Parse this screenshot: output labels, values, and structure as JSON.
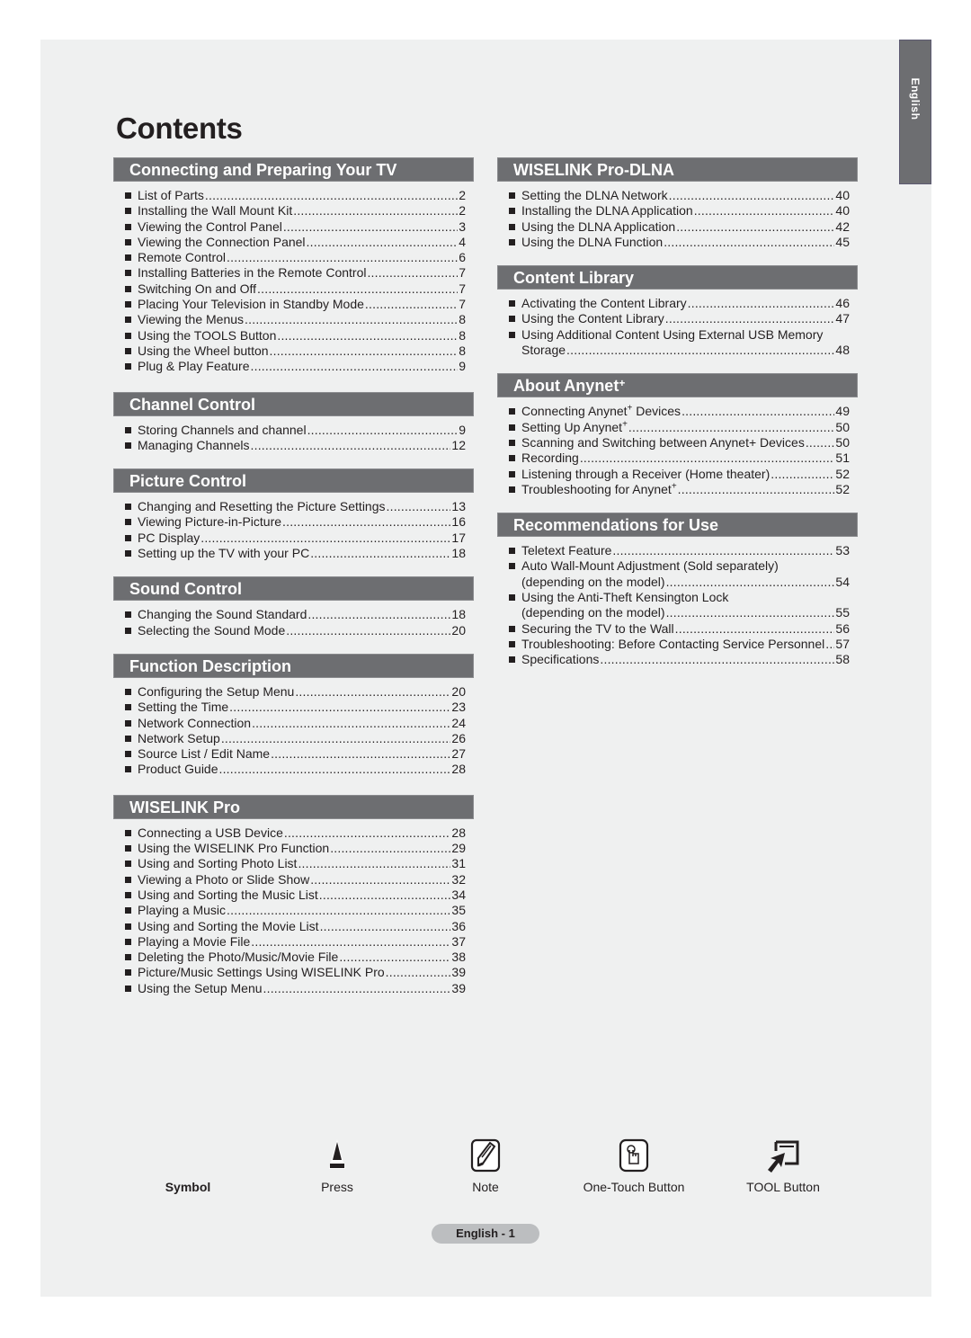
{
  "side_tab": "English",
  "title": "Contents",
  "left_sections": [
    {
      "title": "Connecting and Preparing Your TV",
      "items": [
        {
          "label": "List of Parts",
          "page": "2"
        },
        {
          "label": "Installing the Wall Mount Kit",
          "page": "2"
        },
        {
          "label": "Viewing the Control Panel",
          "page": "3"
        },
        {
          "label": "Viewing the Connection Panel",
          "page": "4"
        },
        {
          "label": "Remote Control",
          "page": "6"
        },
        {
          "label": "Installing Batteries in the Remote Control",
          "page": "7"
        },
        {
          "label": "Switching On and Off",
          "page": "7"
        },
        {
          "label": "Placing Your Television in Standby Mode",
          "page": "7"
        },
        {
          "label": "Viewing the Menus",
          "page": "8"
        },
        {
          "label": "Using the TOOLS Button",
          "page": "8"
        },
        {
          "label": "Using the Wheel button",
          "page": "8"
        },
        {
          "label": "Plug & Play Feature",
          "page": "9"
        }
      ]
    },
    {
      "title": "Channel Control",
      "items": [
        {
          "label": "Storing Channels and channel",
          "page": "9"
        },
        {
          "label": "Managing Channels",
          "page": "12"
        }
      ]
    },
    {
      "title": "Picture Control",
      "items": [
        {
          "label": "Changing and Resetting the Picture Settings",
          "page": "13"
        },
        {
          "label": "Viewing Picture-in-Picture",
          "page": "16"
        },
        {
          "label": "PC Display",
          "page": "17"
        },
        {
          "label": "Setting up the TV with your PC",
          "page": "18"
        }
      ]
    },
    {
      "title": "Sound Control",
      "items": [
        {
          "label": "Changing the Sound Standard",
          "page": "18"
        },
        {
          "label": "Selecting the Sound Mode",
          "page": "20"
        }
      ]
    },
    {
      "title": "Function Description",
      "items": [
        {
          "label": "Configuring the Setup Menu",
          "page": "20"
        },
        {
          "label": "Setting the Time",
          "page": "23"
        },
        {
          "label": "Network Connection",
          "page": "24"
        },
        {
          "label": "Network Setup",
          "page": "26"
        },
        {
          "label": "Source List / Edit Name",
          "page": "27"
        },
        {
          "label": "Product Guide",
          "page": "28"
        }
      ]
    },
    {
      "title": "WISELINK Pro",
      "items": [
        {
          "label": "Connecting a USB Device",
          "page": "28"
        },
        {
          "label": "Using the WISELINK Pro Function",
          "page": "29"
        },
        {
          "label": "Using and Sorting Photo List",
          "page": "31"
        },
        {
          "label": "Viewing a Photo or Slide Show",
          "page": "32"
        },
        {
          "label": "Using and Sorting the Music List",
          "page": "34"
        },
        {
          "label": "Playing a Music",
          "page": "35"
        },
        {
          "label": "Using and Sorting the Movie List",
          "page": "36"
        },
        {
          "label": "Playing a Movie File",
          "page": "37"
        },
        {
          "label": "Deleting the Photo/Music/Movie File",
          "page": "38"
        },
        {
          "label": "Picture/Music Settings Using WISELINK Pro",
          "page": "39"
        },
        {
          "label": "Using the Setup Menu",
          "page": "39"
        }
      ]
    }
  ],
  "right_sections": [
    {
      "title": "WISELINK Pro-DLNA",
      "items": [
        {
          "label": "Setting the DLNA Network",
          "page": "40"
        },
        {
          "label": "Installing the DLNA Application",
          "page": "40"
        },
        {
          "label": "Using the DLNA Application",
          "page": "42"
        },
        {
          "label": "Using the DLNA Function",
          "page": "45"
        }
      ]
    },
    {
      "title": "Content Library",
      "items": [
        {
          "label": "Activating the Content Library",
          "page": "46"
        },
        {
          "label": "Using the Content Library",
          "page": "47"
        },
        {
          "label_line1": "Using Additional Content Using External USB Memory",
          "label": "Storage",
          "page": "48"
        }
      ]
    },
    {
      "title": "About Anynet",
      "title_sup": "+",
      "items": [
        {
          "label": "Connecting Anynet",
          "sup": "+",
          "label_after": " Devices",
          "page": "49"
        },
        {
          "label": "Setting Up Anynet",
          "sup": "+",
          "label_after": "",
          "page": "50"
        },
        {
          "label": "Scanning and Switching between Anynet+ Devices",
          "page": "50"
        },
        {
          "label": "Recording",
          "page": "51"
        },
        {
          "label": "Listening through a Receiver (Home theater)",
          "page": "52"
        },
        {
          "label": "Troubleshooting for Anynet",
          "sup": "+",
          "label_after": "",
          "page": "52"
        }
      ]
    },
    {
      "title": "Recommendations for Use",
      "items": [
        {
          "label": "Teletext Feature",
          "page": "53"
        },
        {
          "label_line1": "Auto Wall-Mount Adjustment (Sold separately)",
          "label": "(depending on the model)",
          "page": "54"
        },
        {
          "label_line1": "Using the Anti-Theft Kensington Lock",
          "label": "(depending on the model)",
          "page": "55"
        },
        {
          "label": "Securing the TV to the Wall",
          "page": "56"
        },
        {
          "label": "Troubleshooting: Before Contacting Service Personnel",
          "page": "57"
        },
        {
          "label": "Specifications",
          "page": "58"
        }
      ]
    }
  ],
  "symbols": {
    "header": "Symbol",
    "items": [
      {
        "icon": "press-icon",
        "label": "Press"
      },
      {
        "icon": "note-icon",
        "label": "Note"
      },
      {
        "icon": "one-touch-button-icon",
        "label": "One-Touch Button"
      },
      {
        "icon": "tool-button-icon",
        "label": "TOOL Button"
      }
    ]
  },
  "footer": "English - 1",
  "colors": {
    "section_header_bg": "#6d6e71",
    "page_bg": "#eff0f0",
    "footer_pill_bg": "#bcbec0",
    "text": "#231f20"
  }
}
